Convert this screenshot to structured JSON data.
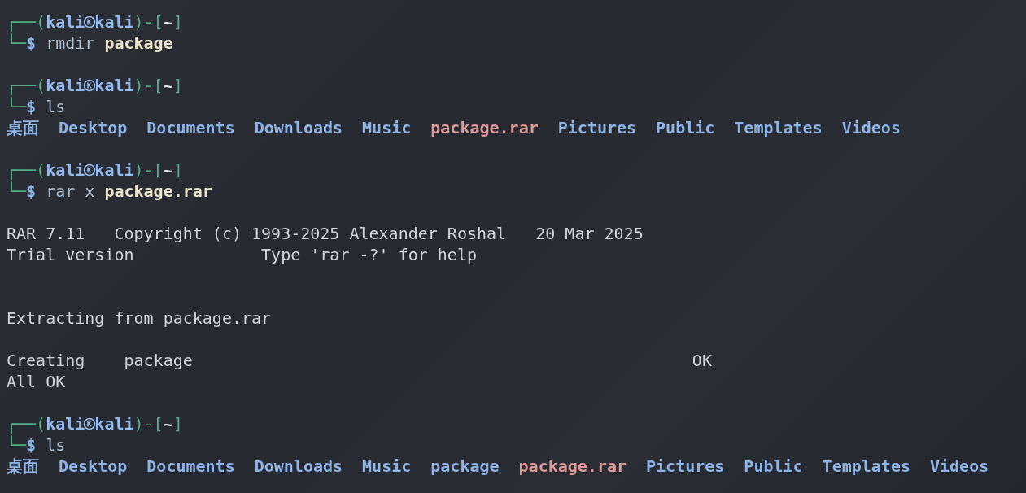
{
  "lines": [
    {
      "kind": "prompt",
      "frame_open": "┌──(",
      "user": "kali",
      "host": "kali",
      "frame_mid": ")-[",
      "dir": "~",
      "frame_close": "]"
    },
    {
      "kind": "command",
      "frame": "└─",
      "symbol": "$",
      "text": "rmdir **package**"
    },
    {
      "kind": "blank"
    },
    {
      "kind": "prompt",
      "frame_open": "┌──(",
      "user": "kali",
      "host": "kali",
      "frame_mid": ")-[",
      "dir": "~",
      "frame_close": "]"
    },
    {
      "kind": "command",
      "frame": "└─",
      "symbol": "$",
      "text": "ls"
    },
    {
      "kind": "listing",
      "entries": [
        {
          "name": "桌面",
          "color": "#8fb4e6"
        },
        {
          "name": "Desktop",
          "color": "#8fb4e6"
        },
        {
          "name": "Documents",
          "color": "#8fb4e6"
        },
        {
          "name": "Downloads",
          "color": "#8fb4e6"
        },
        {
          "name": "Music",
          "color": "#8fb4e6"
        },
        {
          "name": "package.rar",
          "color": "#e09a9a"
        },
        {
          "name": "Pictures",
          "color": "#8fb4e6"
        },
        {
          "name": "Public",
          "color": "#8fb4e6"
        },
        {
          "name": "Templates",
          "color": "#8fb4e6"
        },
        {
          "name": "Videos",
          "color": "#8fb4e6"
        }
      ]
    },
    {
      "kind": "blank"
    },
    {
      "kind": "prompt",
      "frame_open": "┌──(",
      "user": "kali",
      "host": "kali",
      "frame_mid": ")-[",
      "dir": "~",
      "frame_close": "]"
    },
    {
      "kind": "command",
      "frame": "└─",
      "symbol": "$",
      "text": "rar x **package.rar**"
    },
    {
      "kind": "blank"
    },
    {
      "kind": "output",
      "text": "RAR 7.11   Copyright (c) 1993-2025 Alexander Roshal   20 Mar 2025"
    },
    {
      "kind": "output",
      "text": "Trial version             Type 'rar -?' for help"
    },
    {
      "kind": "blank"
    },
    {
      "kind": "blank"
    },
    {
      "kind": "output",
      "text": "Extracting from package.rar"
    },
    {
      "kind": "blank"
    },
    {
      "kind": "output",
      "text": "Creating    package                                                   OK"
    },
    {
      "kind": "output",
      "text": "All OK"
    },
    {
      "kind": "blank"
    },
    {
      "kind": "prompt",
      "frame_open": "┌──(",
      "user": "kali",
      "host": "kali",
      "frame_mid": ")-[",
      "dir": "~",
      "frame_close": "]"
    },
    {
      "kind": "command",
      "frame": "└─",
      "symbol": "$",
      "text": "ls"
    },
    {
      "kind": "listing",
      "entries": [
        {
          "name": "桌面",
          "color": "#8fb4e6"
        },
        {
          "name": "Desktop",
          "color": "#8fb4e6"
        },
        {
          "name": "Documents",
          "color": "#8fb4e6"
        },
        {
          "name": "Downloads",
          "color": "#8fb4e6"
        },
        {
          "name": "Music",
          "color": "#8fb4e6"
        },
        {
          "name": "package",
          "color": "#8fb4e6"
        },
        {
          "name": "package.rar",
          "color": "#e09a9a"
        },
        {
          "name": "Pictures",
          "color": "#8fb4e6"
        },
        {
          "name": "Public",
          "color": "#8fb4e6"
        },
        {
          "name": "Templates",
          "color": "#8fb4e6"
        },
        {
          "name": "Videos",
          "color": "#8fb4e6"
        }
      ]
    }
  ]
}
